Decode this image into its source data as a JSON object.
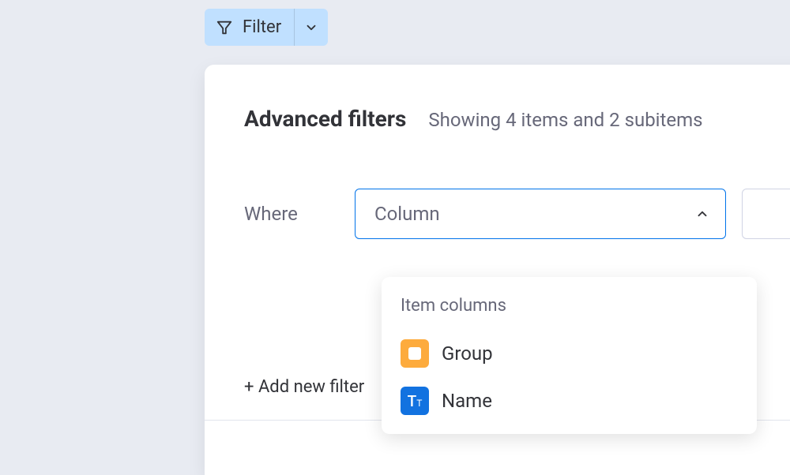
{
  "filter_button": {
    "label": "Filter"
  },
  "panel": {
    "title": "Advanced filters",
    "subtitle": "Showing 4 items and 2 subitems",
    "where_label": "Where",
    "column_placeholder": "Column",
    "add_filter_label": "+ Add new filter"
  },
  "dropdown": {
    "section_title": "Item columns",
    "items": [
      {
        "label": "Group"
      },
      {
        "label": "Name"
      }
    ]
  }
}
